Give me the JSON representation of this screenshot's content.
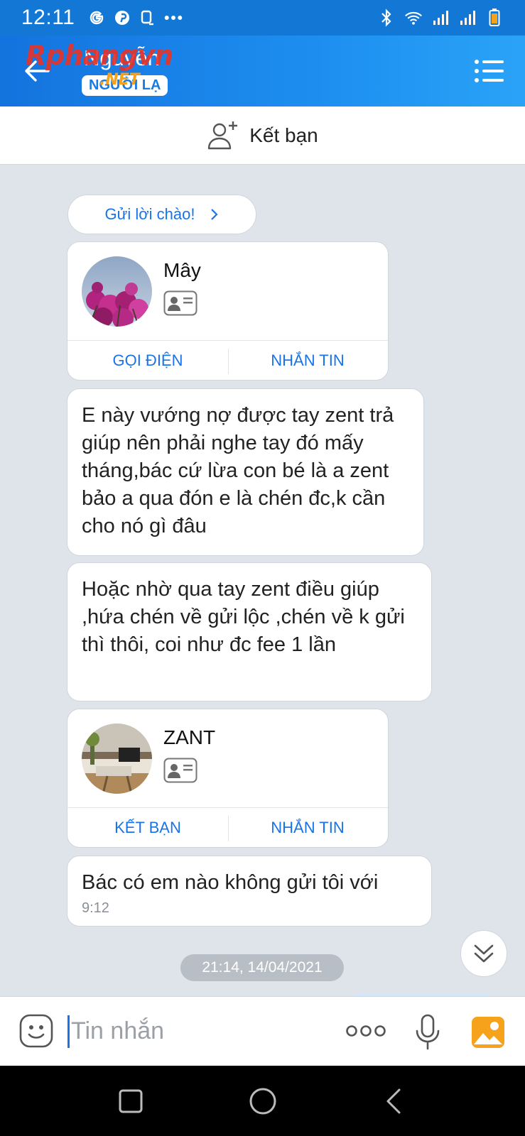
{
  "status_bar": {
    "time": "12:11"
  },
  "header": {
    "contact_name": "Nguyễn",
    "stranger_badge": "NGƯỜI LẠ",
    "watermark_main": "Rphangvn",
    "watermark_suffix": ".NET"
  },
  "friend_bar": {
    "label": "Kết bạn"
  },
  "chat": {
    "greet_button": "Gửi lời chào!",
    "card_1": {
      "name": "Mây",
      "call_label": "GỌI ĐIỆN",
      "message_label": "NHẮN TIN"
    },
    "message_1": "E này vướng nợ được tay zent trả giúp nên phải nghe tay đó mấy tháng,bác cứ lừa con bé là a zent bảo a qua đón e là chén đc,k cần cho nó gì đâu",
    "message_2": "Hoặc nhờ qua tay zent điều giúp ,hứa chén về gửi lộc ,chén về k gửi thì thôi, coi như đc fee 1 lần",
    "card_2": {
      "name": "ZANT",
      "add_friend_label": "KẾT BẠN",
      "message_label": "NHẮN TIN"
    },
    "message_3": "Bác có em nào không gửi tôi với",
    "message_3_time": "9:12",
    "date_separator": "21:14, 14/04/2021"
  },
  "input_bar": {
    "placeholder": "Tin nhắn"
  },
  "colors": {
    "header_start": "#1473de",
    "header_end": "#2aa3f7",
    "accent": "#1a73e8",
    "chat_background": "#dfe4ea"
  }
}
